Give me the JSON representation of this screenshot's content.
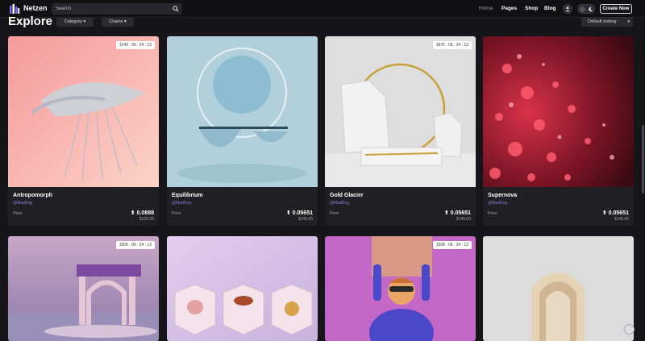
{
  "header": {
    "brand": "Netzen",
    "search_placeholder": "Search",
    "nav": [
      "Home",
      "Pages",
      "Shop",
      "Blog"
    ],
    "create_label": "Create Now",
    "icons": [
      "logo-icon",
      "search-icon",
      "user-icon",
      "sun-icon",
      "moon-icon"
    ]
  },
  "page": {
    "title": "Explore",
    "filters": [
      "Category ▾",
      "Chains ▾"
    ],
    "sort_label": "Default sorting",
    "sort_caret": "▾"
  },
  "cards": [
    {
      "title": "Antropomorph",
      "author": "@MadDog",
      "price_label": "Price",
      "price": "⬆ 0.0888",
      "usd": "$220.00",
      "timer": "1149 : 09 : 24 : 13",
      "theme": "#f5b4b4"
    },
    {
      "title": "Equilibrium",
      "author": "@MadDog",
      "price_label": "Price",
      "price": "⬆ 0.05651",
      "usd": "$140.00",
      "timer": "",
      "theme": "#a9cbd9"
    },
    {
      "title": "Gold Glacier",
      "author": "@MadDog",
      "price_label": "Price",
      "price": "⬆ 0.05651",
      "usd": "$140.00",
      "timer": "1875 : 09 : 24 : 13",
      "theme": "#dcdcdc"
    },
    {
      "title": "Supernova",
      "author": "@MadDog",
      "price_label": "Price",
      "price": "⬆ 0.05651",
      "usd": "$140.00",
      "timer": "",
      "theme": "#3a0b12"
    }
  ],
  "cards_row2": [
    {
      "timer": "1505 : 09 : 24 : 13",
      "theme": "#b58db6"
    },
    {
      "timer": "",
      "theme": "#d9c8ea"
    },
    {
      "timer": "1508 : 09 : 24 : 13",
      "theme": "#c967c9"
    },
    {
      "timer": "",
      "theme": "#d9d9d9"
    }
  ]
}
